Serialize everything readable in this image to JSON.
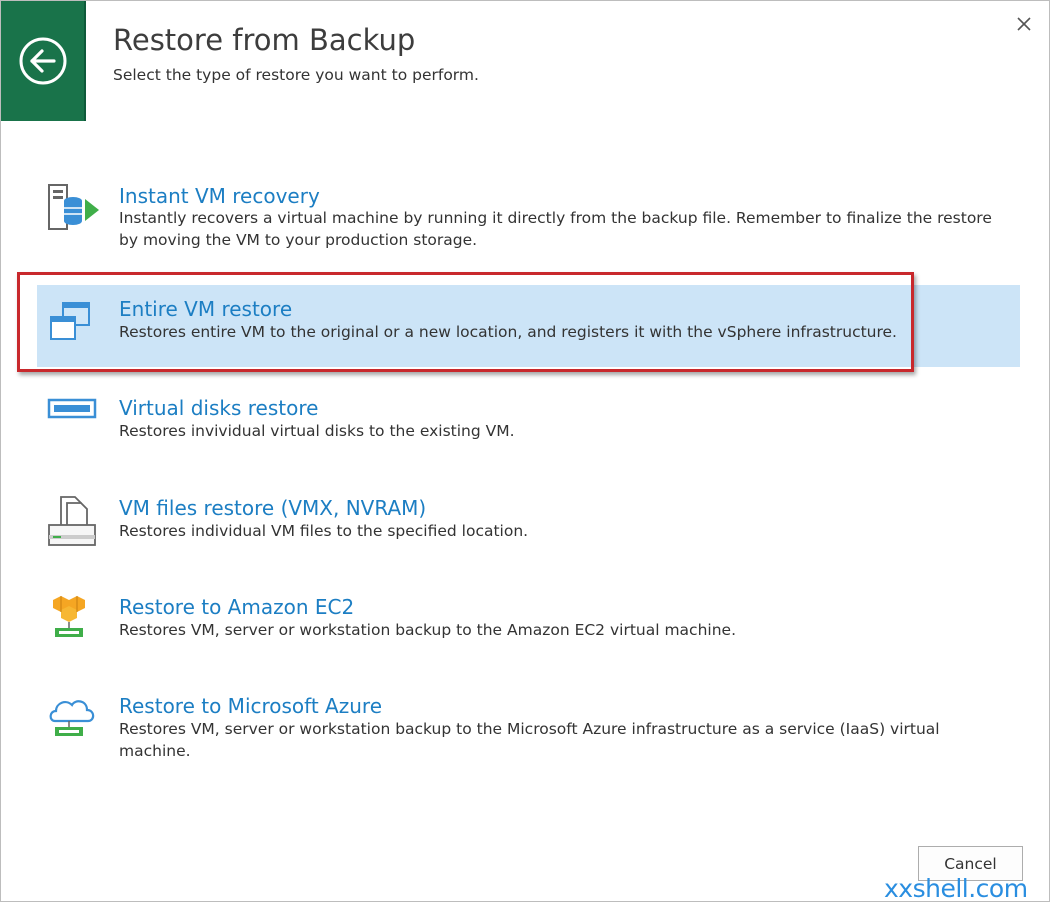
{
  "header": {
    "title": "Restore from Backup",
    "subtitle": "Select the type of restore you want to perform."
  },
  "options": [
    {
      "title": "Instant VM recovery",
      "description": "Instantly recovers a virtual machine by running it directly from the backup file. Remember to finalize the restore by moving the VM to your production storage.",
      "icon": "instant-recovery-icon"
    },
    {
      "title": "Entire VM restore",
      "description": "Restores entire VM to the original or a new location, and registers it with the vSphere infrastructure.",
      "icon": "entire-vm-icon",
      "selected": true
    },
    {
      "title": "Virtual disks restore",
      "description": "Restores invividual virtual disks to the existing VM.",
      "icon": "virtual-disk-icon"
    },
    {
      "title": "VM files restore (VMX, NVRAM)",
      "description": "Restores individual VM files to the specified location.",
      "icon": "vm-files-icon"
    },
    {
      "title": "Restore to Amazon EC2",
      "description": "Restores VM, server or workstation backup to the Amazon EC2 virtual machine.",
      "icon": "amazon-ec2-icon"
    },
    {
      "title": "Restore to Microsoft Azure",
      "description": "Restores VM, server or workstation backup to the Microsoft Azure infrastructure as a service (IaaS) virtual machine.",
      "icon": "azure-cloud-icon"
    }
  ],
  "footer": {
    "cancel_label": "Cancel"
  },
  "watermark": "xxshell.com",
  "colors": {
    "accent_green": "#19734a",
    "link_blue": "#1c7ec3",
    "selection_bg": "#cce4f7",
    "highlight_red": "#c8282c"
  }
}
